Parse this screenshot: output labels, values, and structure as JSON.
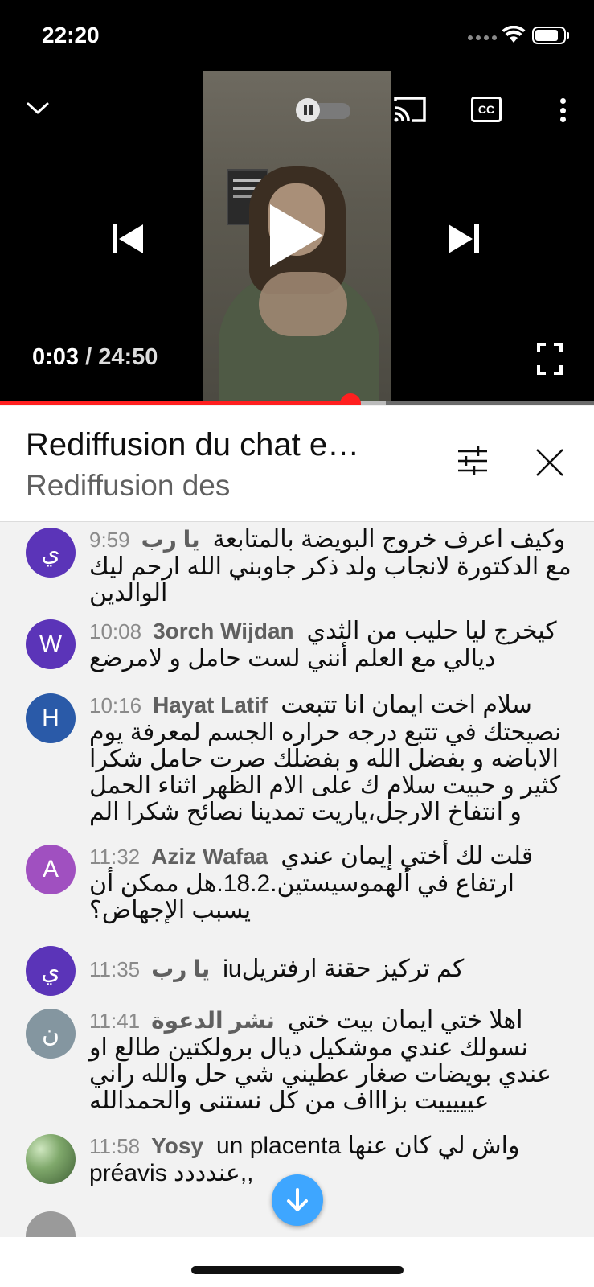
{
  "status_bar": {
    "time": "22:20"
  },
  "player": {
    "current_time": "0:03",
    "separator": " / ",
    "duration": "24:50",
    "progress_fraction": 0.59,
    "icons": {
      "collapse": "chevron-down-icon",
      "autoplay": "autoplay-toggle-icon",
      "cast": "cast-icon",
      "captions": "closed-captions-icon",
      "more": "more-vertical-icon",
      "previous": "skip-previous-icon",
      "play": "play-icon",
      "next": "skip-next-icon",
      "fullscreen": "fullscreen-icon"
    },
    "captions_label": "CC",
    "colors": {
      "progress": "#ff1f1f"
    }
  },
  "chat_header": {
    "title": "Rediffusion du chat e…",
    "subtitle": "Rediffusion des"
  },
  "messages": [
    {
      "avatar_letter": "ي",
      "avatar_color": "#5b34b8",
      "time": "9:59",
      "author": "يا رب",
      "text": "وكيف اعرف خروج البويضة بالمتابعة مع الدكتورة لانجاب ولد ذكر جاوبني الله ارحم ليك الوالدين"
    },
    {
      "avatar_letter": "W",
      "avatar_color": "#5b34b8",
      "time": "10:08",
      "author": "3orch Wijdan",
      "text": "كيخرج ليا حليب من الثدي ديالي مع العلم أنني لست حامل و لامرضع"
    },
    {
      "avatar_letter": "H",
      "avatar_color": "#2a5aa8",
      "time": "10:16",
      "author": "Hayat Latif",
      "text": "سلام اخت ايمان انا تتبعت نصيحتك في تتبع درجه حراره الجسم لمعرفة يوم الاباضه و بفضل الله و بفضلك صرت حامل شكرا كثير و حبيت سلام ك على الام الظهر اثناء الحمل و انتفاخ الارجل،ياريت تمدينا نصائح شكرا الم"
    },
    {
      "avatar_letter": "A",
      "avatar_color": "#a050c0",
      "time": "11:32",
      "author": "Aziz Wafaa",
      "text": "قلت لك أختي إيمان عندي ارتفاع في ألهموسيستين.18.2.هل ممكن أن يسبب الإجهاض؟"
    },
    {
      "avatar_letter": "ي",
      "avatar_color": "#5b34b8",
      "time": "11:35",
      "author": "يا رب",
      "text": "iuكم تركيز حقنة ارفتريل"
    },
    {
      "avatar_letter": "ن",
      "avatar_color": "#8496a0",
      "time": "11:41",
      "author": "نشر الدعوة",
      "text": "اهلا ختي ايمان بيت ختي نسولك عندي موشكيل ديال برولكتين طالع او عندي بويضات صغار عطيني شي حل والله راني عيييييت بزاااف من كل نستنى والحمدالله"
    },
    {
      "avatar_letter": "",
      "avatar_color": "#7fa86b",
      "avatar_icon": "profile-photo-avatar",
      "time": "11:58",
      "author": "Yosy",
      "text": "un placenta واش لي كان عنها préavis عندددد,,"
    }
  ],
  "jump_to_latest": {
    "icon": "arrow-down-icon"
  }
}
